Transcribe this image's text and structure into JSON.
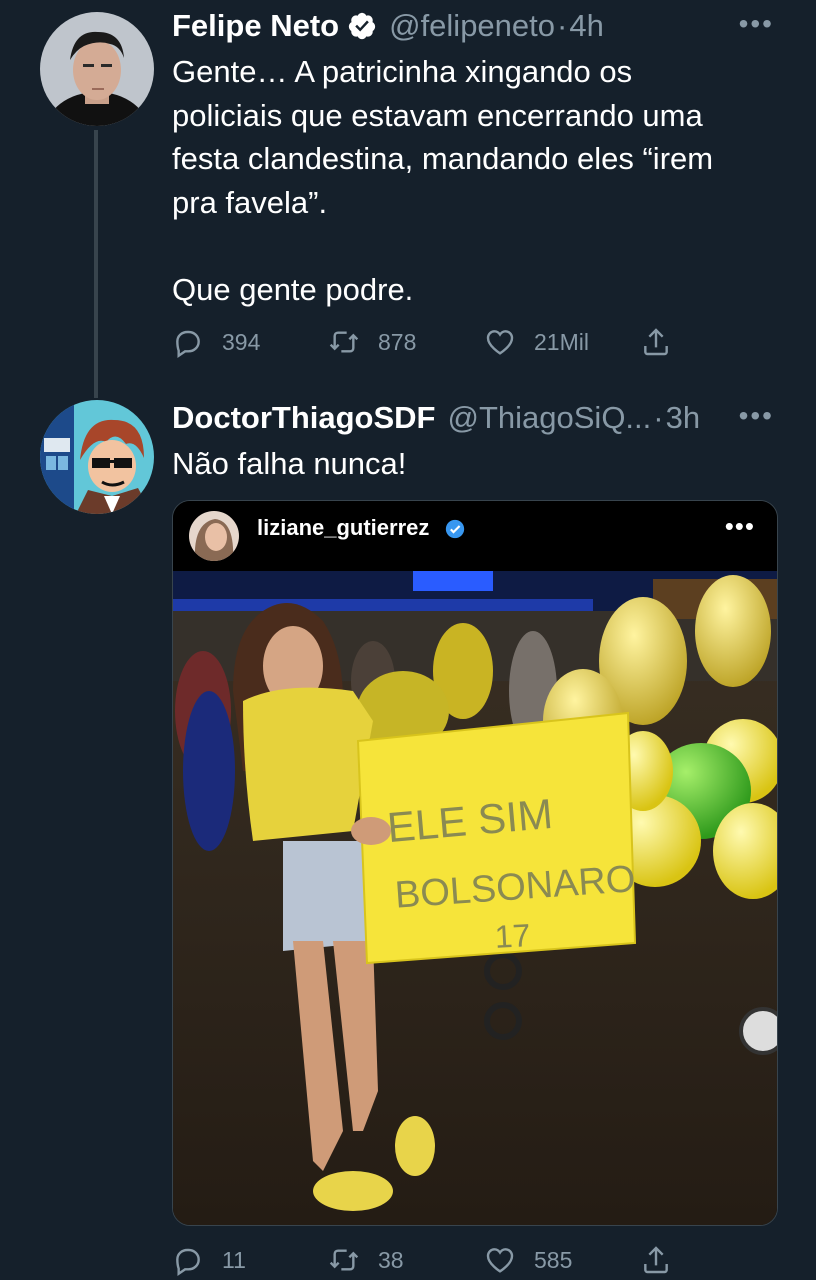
{
  "tweets": [
    {
      "name": "Felipe Neto",
      "handle": "@felipeneto",
      "separator": "·",
      "time": "4h",
      "more": "•••",
      "text_lines": [
        "Gente… A patricinha xingando os",
        "policiais que estavam encerrando uma",
        "festa clandestina, mandando eles “irem",
        "pra favela”.",
        "",
        "Que gente podre."
      ],
      "replies": "394",
      "retweets": "878",
      "likes": "21Mil"
    },
    {
      "name": "DoctorThiagoSDF",
      "handle": "@ThiagoSiQ...",
      "separator": "·",
      "time": "3h",
      "more": "•••",
      "text": "Não falha nunca!",
      "replies": "11",
      "retweets": "38",
      "likes": "585"
    }
  ],
  "embedded_post": {
    "username": "liziane_gutierrez",
    "more": "•••",
    "sign_lines": [
      "ELE SIM",
      "BOLSONARO",
      "17"
    ]
  },
  "colors": {
    "background": "#15202b",
    "secondary_text": "#8899a6",
    "verified_blue": "#ffffff",
    "ig_verified": "#3897f0"
  }
}
